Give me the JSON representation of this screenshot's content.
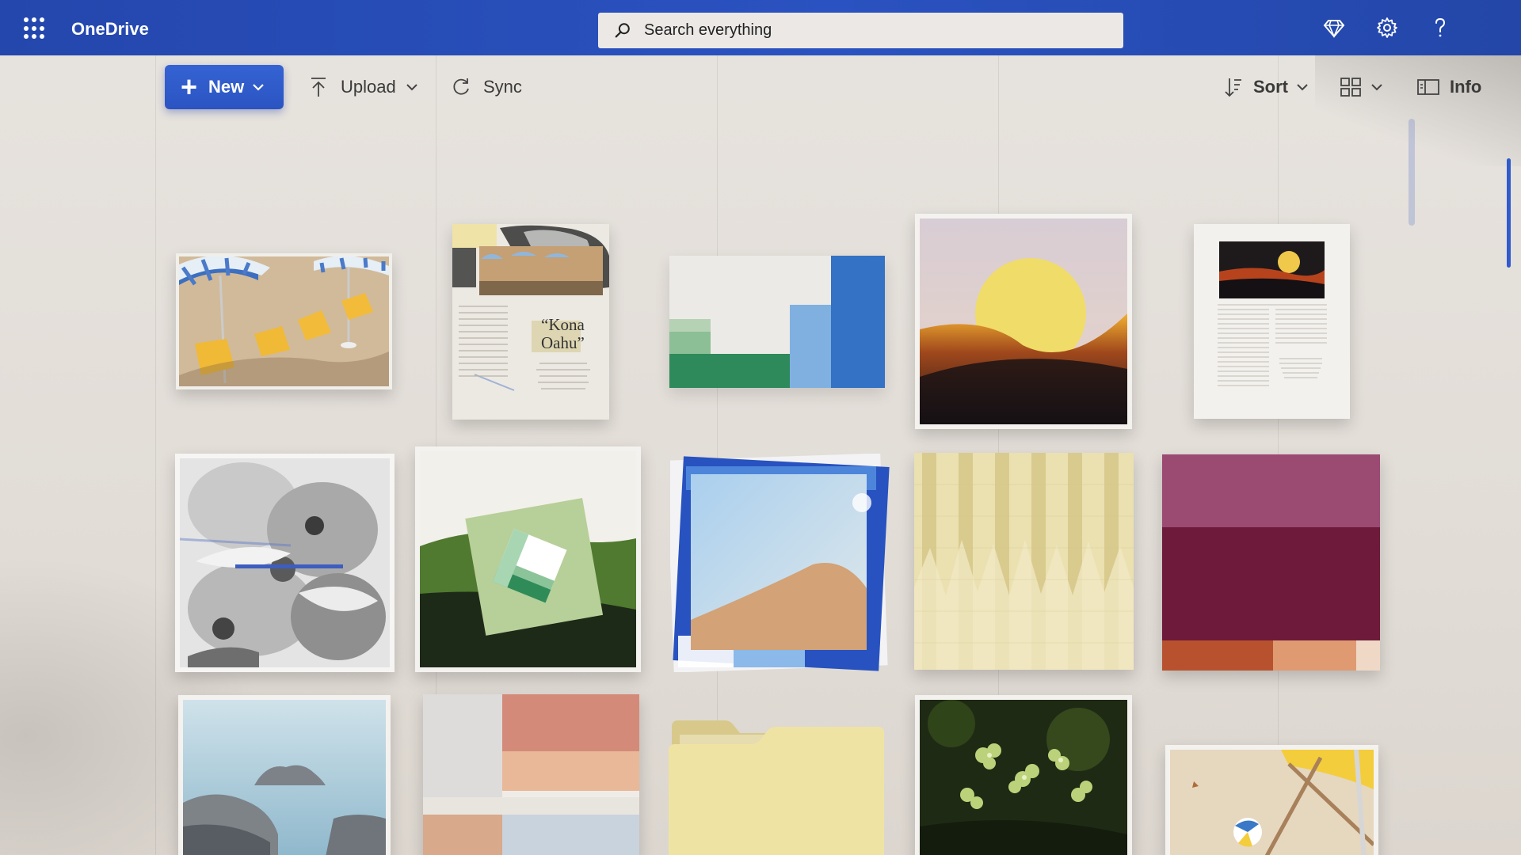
{
  "app": {
    "name": "OneDrive"
  },
  "search": {
    "placeholder": "Search everything"
  },
  "header_icons": [
    "diamond-icon",
    "gear-icon",
    "help-icon"
  ],
  "commands": {
    "new_label": "New",
    "upload_label": "Upload",
    "sync_label": "Sync",
    "sort_label": "Sort",
    "info_label": "Info"
  },
  "documents": {
    "kona_title": "“Kona\nOahu”"
  },
  "colors": {
    "header_blue": "#2447ad",
    "accent": "#2f5bcc",
    "folder_yellow": "#efe3a4"
  }
}
